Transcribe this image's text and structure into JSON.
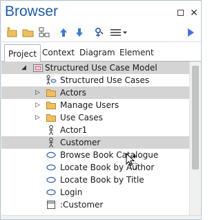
{
  "window": {
    "title": "Browser",
    "controls": {
      "maximize": "maximize-icon",
      "close": "✕"
    }
  },
  "toolbar": {
    "icons": [
      "new-package-icon",
      "folder-icon",
      "diagram-icon",
      "move-up-icon",
      "move-down-icon",
      "locate-icon",
      "menu-icon",
      "expand-right-icon"
    ]
  },
  "tabs": [
    {
      "label": "Project",
      "active": true
    },
    {
      "label": "Context",
      "active": false
    },
    {
      "label": "Diagram",
      "active": false
    },
    {
      "label": "Element",
      "active": false
    }
  ],
  "tree": {
    "rows": [
      {
        "label": "Structured Use Case Model",
        "icon": "model-package-icon",
        "expander": "◢",
        "selected": true
      },
      {
        "label": "Structured Use Cases",
        "icon": "use-case-diagram-icon",
        "expander": "",
        "selected": false
      },
      {
        "label": "Actors",
        "icon": "folder-icon",
        "expander": "▷",
        "selected": true
      },
      {
        "label": "Manage Users",
        "icon": "folder-icon",
        "expander": "▷",
        "selected": false
      },
      {
        "label": "Use Cases",
        "icon": "folder-icon",
        "expander": "▷",
        "selected": false
      },
      {
        "label": "Actor1",
        "icon": "actor-icon",
        "expander": "",
        "selected": false
      },
      {
        "label": "Customer",
        "icon": "actor-icon",
        "expander": "",
        "selected": true
      },
      {
        "label": "Browse Book Catalogue",
        "icon": "use-case-icon",
        "expander": "",
        "selected": false
      },
      {
        "label": "Locate Book by Author",
        "icon": "use-case-icon",
        "expander": "",
        "selected": false
      },
      {
        "label": "Locate Book by Title",
        "icon": "use-case-icon",
        "expander": "",
        "selected": false
      },
      {
        "label": "Login",
        "icon": "use-case-icon",
        "expander": "",
        "selected": false
      },
      {
        "label": ":Customer",
        "icon": "instance-icon",
        "expander": "",
        "selected": false
      }
    ]
  },
  "colors": {
    "title": "#1e5aa8",
    "selection": "#d4d4d4",
    "folder": "#f0c060",
    "toolbar_icon_blue": "#3a7bd5"
  }
}
